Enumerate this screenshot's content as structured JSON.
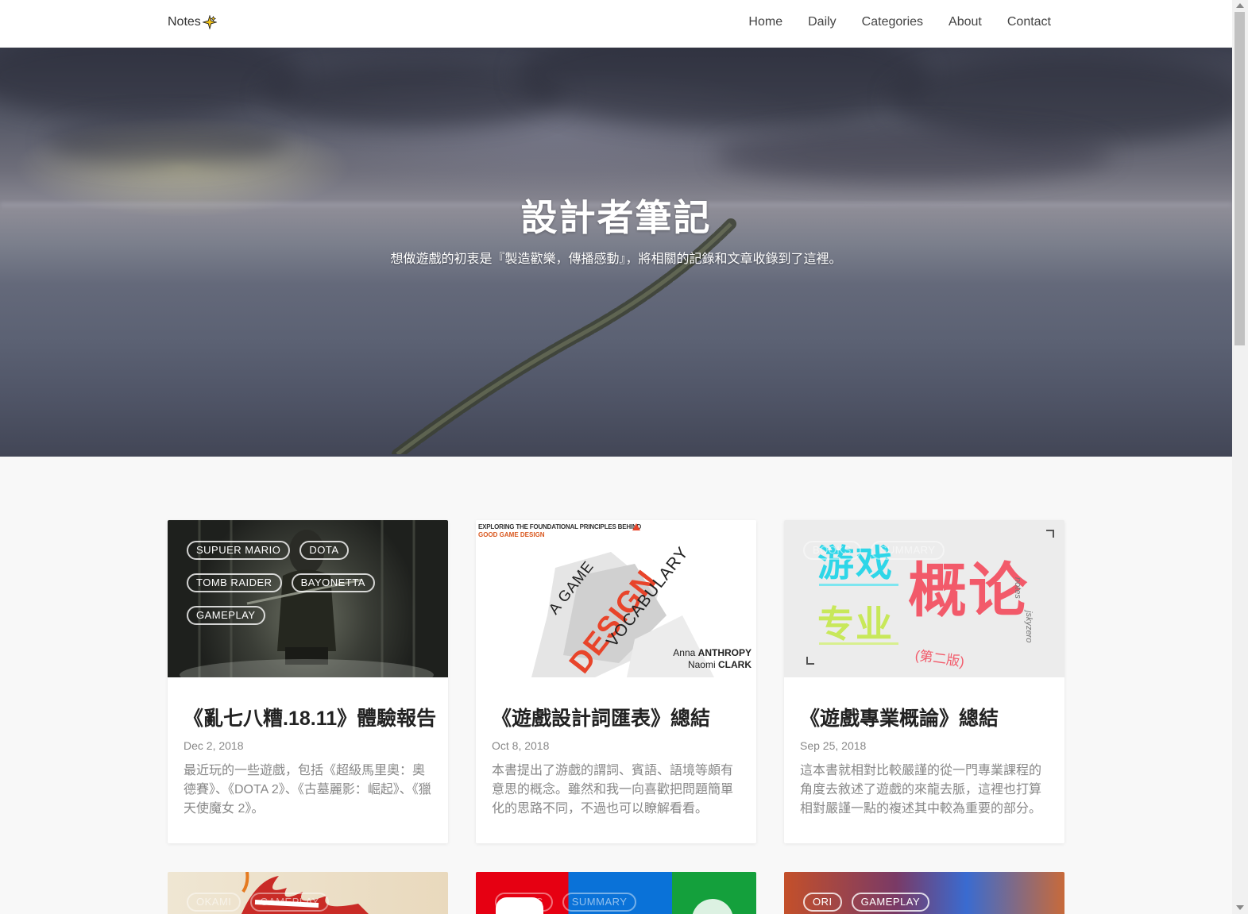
{
  "nav": {
    "brand": "Notes",
    "links": [
      "Home",
      "Daily",
      "Categories",
      "About",
      "Contact"
    ]
  },
  "hero": {
    "title": "設計者筆記",
    "subtitle": "想做遊戲的初衷是『製造歡樂，傳播感動』，將相關的記錄和文章收錄到了這裡。"
  },
  "posts": [
    {
      "title": "《亂七八糟.18.11》體驗報告",
      "date": "Dec 2, 2018",
      "excerpt": "最近玩的一些遊戲，包括《超級馬里奧：奧德賽》、《DOTA 2》、《古墓麗影：崛起》、《獵天使魔女 2》。",
      "tags": [
        "SUPUER MARIO",
        "DOTA",
        "TOMB RAIDER",
        "BAYONETTA",
        "GAMEPLAY"
      ]
    },
    {
      "title": "《遊戲設計詞匯表》總結",
      "date": "Oct 8, 2018",
      "excerpt": "本書提出了游戲的謂詞、賓語、語境等頗有意思的概念。雖然和我一向喜歡把問題簡單化的思路不同，不過也可以瞭解看看。",
      "tags": [],
      "cover": {
        "top_line": "EXPLORING THE FOUNDATIONAL PRINCIPLES BEHIND",
        "top_line2": "GOOD GAME DESIGN",
        "w1": "A GAME",
        "w2": "DESIGN",
        "w3": "VOCABULARY",
        "author1_first": "Anna",
        "author1_last": "ANTHROPY",
        "author2_first": "Naomi",
        "author2_last": "CLARK"
      }
    },
    {
      "title": "《遊戲專業概論》總結",
      "date": "Sep 25, 2018",
      "excerpt": "這本書就相對比較嚴謹的從一門專業課程的角度去敘述了遊戲的來龍去脈，這裡也打算相對嚴謹一點的複述其中較為重要的部分。",
      "tags": [
        "BOOKS",
        "SUMMARY"
      ],
      "cover": {
        "c1": "游戏",
        "c2": "专业",
        "c3": "概论",
        "c4": "(第二版)",
        "side": "notes",
        "side2": "jskyzero"
      }
    }
  ],
  "next_row_tags": [
    [
      "OKAMI",
      "GAMEPLAY"
    ],
    [
      "BOOKS",
      "SUMMARY"
    ],
    [
      "ORI",
      "GAMEPLAY"
    ]
  ],
  "colors": {
    "accent": "#e8442a",
    "nav_bg": "#ffffff",
    "page_bg": "#f8f8f8"
  }
}
